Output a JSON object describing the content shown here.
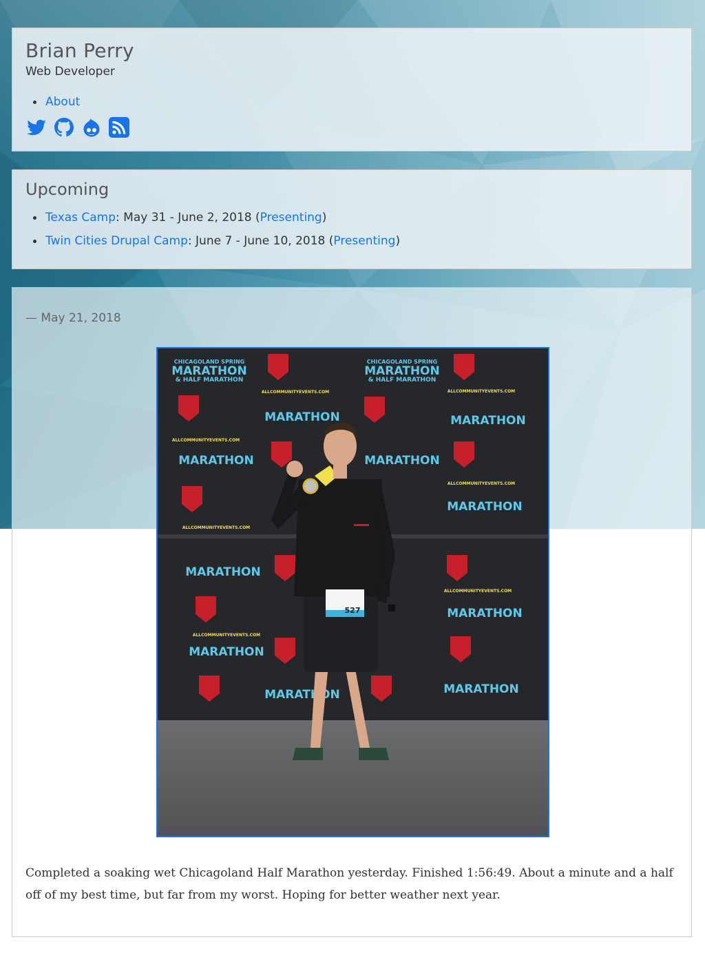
{
  "site": {
    "title": "Brian Perry",
    "subtitle": "Web Developer",
    "nav": [
      {
        "label": "About"
      }
    ],
    "social": [
      {
        "icon": "twitter-icon",
        "color": "#1da1f2"
      },
      {
        "icon": "github-icon",
        "color": "#1a73e8"
      },
      {
        "icon": "drupal-icon",
        "color": "#1a73e8"
      },
      {
        "icon": "rss-icon",
        "color": "#1a73e8"
      }
    ]
  },
  "upcoming": {
    "title": "Upcoming",
    "events": [
      {
        "name": "Texas Camp",
        "dates": ": May 31 - June 2, 2018 (",
        "role": "Presenting",
        "close": ")"
      },
      {
        "name": "Twin Cities Drupal Camp",
        "dates": ": June 7 - June 10, 2018 (",
        "role": "Presenting",
        "close": ")"
      }
    ]
  },
  "post": {
    "date": "— May 21, 2018",
    "image_alt": "Runner holding a medal in front of a Chicagoland Spring Marathon & Half Marathon backdrop",
    "banner_lines": [
      "CHICAGOLAND SPRING",
      "MARATHON",
      "& HALF MARATHON",
      "ALLCOMMUNITYEVENTS.COM"
    ],
    "bib": "527",
    "body": "Completed a soaking wet Chicagoland Half Marathon yesterday. Finished 1:56:49. About a minute and a half off of my best time, but far from my worst. Hoping for better weather next year."
  },
  "colors": {
    "link": "#1a73e8",
    "header_bg_top": "#16657f",
    "header_bg_light": "#a9cfdc",
    "card_bg": "#ecf3f6"
  }
}
